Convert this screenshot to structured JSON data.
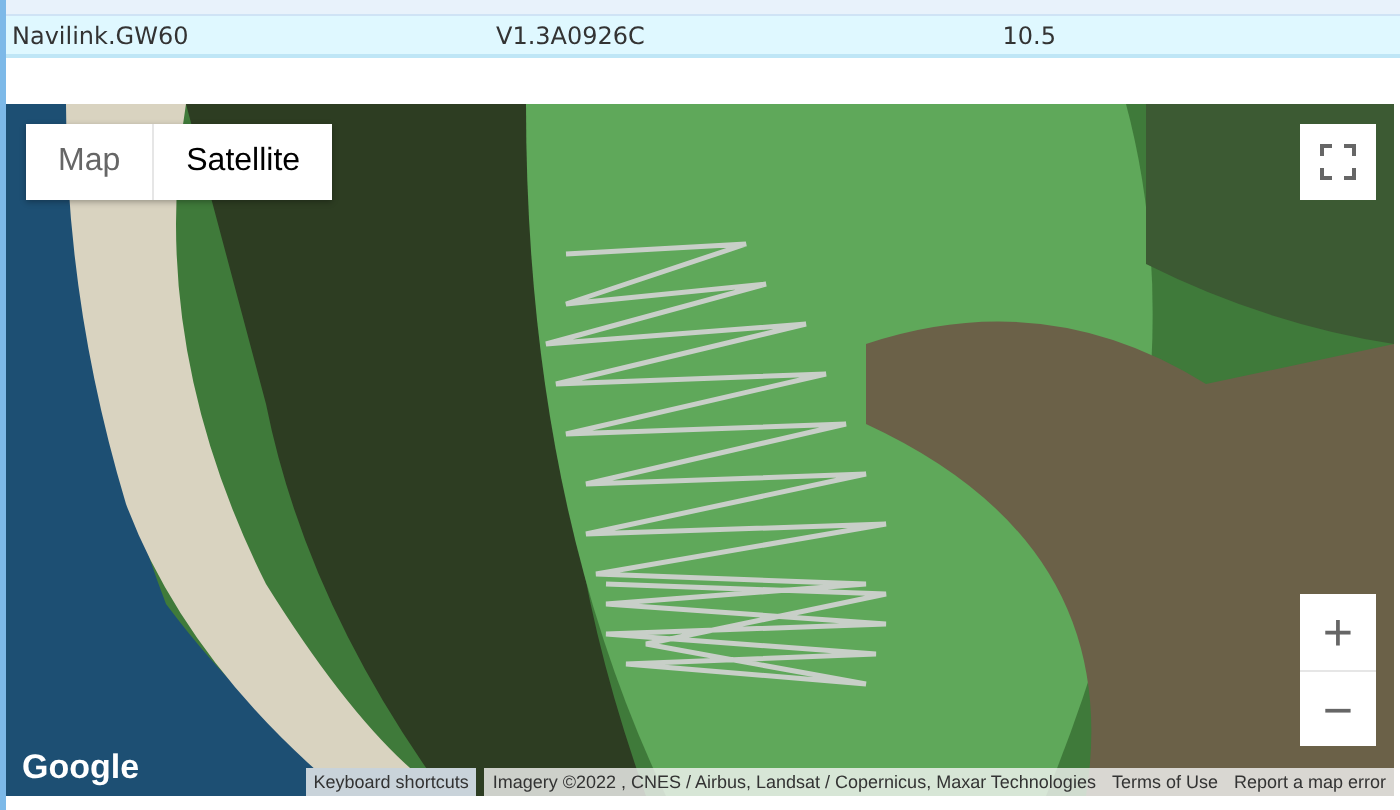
{
  "table": {
    "rows": [
      {
        "gps_type": "Navilink.GW60",
        "firmware": "V1.3A0926C",
        "time_zone": "10.5"
      }
    ]
  },
  "map": {
    "map_types": [
      {
        "label": "Map",
        "selected": false
      },
      {
        "label": "Satellite",
        "selected": true
      }
    ],
    "zoom_buttons": [
      "+",
      "−"
    ],
    "logo": "Google",
    "attribution": [
      {
        "kind": "button",
        "text": "Keyboard shortcuts"
      },
      {
        "kind": "text",
        "text": "Imagery ©2022 , CNES / Airbus, Landsat / Copernicus, Maxar Technologies"
      },
      {
        "kind": "link",
        "text": "Terms of Use"
      },
      {
        "kind": "link",
        "text": "Report a map error"
      }
    ]
  }
}
